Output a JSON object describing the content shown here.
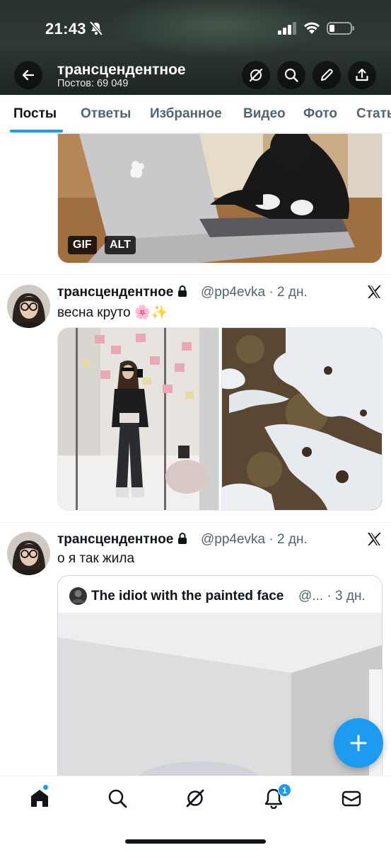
{
  "status_bar": {
    "time": "21:43",
    "battery_level": 0.25
  },
  "header": {
    "account_name": "трансцендентное",
    "posts_count": "Постов: 69 049"
  },
  "tabs": [
    {
      "label": "Посты",
      "active": true
    },
    {
      "label": "Ответы"
    },
    {
      "label": "Избранное"
    },
    {
      "label": "Видео"
    },
    {
      "label": "Фото"
    },
    {
      "label": "Стать"
    }
  ],
  "gif_post": {
    "badges": [
      "GIF",
      "ALT"
    ]
  },
  "posts": [
    {
      "author": "трансцендентное",
      "handle": "@pp4evka",
      "separator": "·",
      "time": "2 дн.",
      "text": "весна круто 🌸✨"
    },
    {
      "author": "трансцендентное",
      "handle": "@pp4evka",
      "separator": "·",
      "time": "2 дн.",
      "text": "о я так жила"
    }
  ],
  "quoted": {
    "author": "The idiot with the painted face",
    "handle_truncated": "@...",
    "time": "· 3 дн."
  },
  "nav": {
    "notifications_badge": "1"
  },
  "colors": {
    "accent": "#1d9bf0",
    "text": "#0f1419",
    "secondary": "#536471"
  },
  "icons": [
    "back-arrow-icon",
    "grok-icon",
    "search-icon",
    "pen-icon",
    "share-icon",
    "lock-icon",
    "x-logo-icon",
    "plus-icon",
    "home-icon",
    "bell-icon",
    "mail-icon"
  ]
}
